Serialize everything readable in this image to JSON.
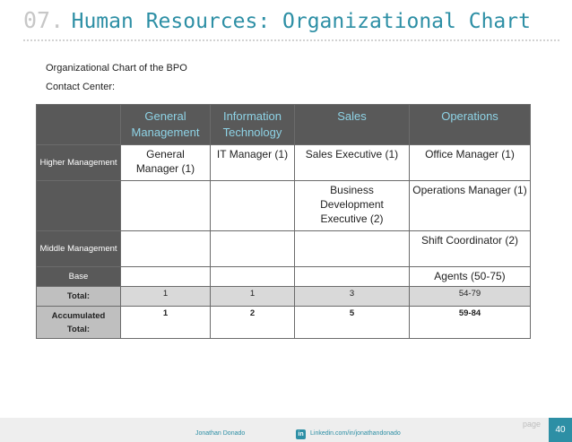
{
  "header": {
    "number": "07.",
    "title": "Human Resources:  Organizational Chart"
  },
  "subtitle": {
    "line1": "Organizational Chart of the BPO",
    "line2": "Contact Center:"
  },
  "table": {
    "columns": [
      "General Management",
      "Information Technology",
      "Sales",
      "Operations"
    ],
    "rows": [
      {
        "label": "Higher Management",
        "cells": [
          "General Manager (1)",
          "IT Manager (1)",
          "Sales Executive (1)",
          "Office Manager (1)"
        ]
      },
      {
        "label": "",
        "cells": [
          "",
          "",
          "Business Development Executive (2)",
          "Operations Manager (1)"
        ]
      },
      {
        "label": "Middle Management",
        "cells": [
          "",
          "",
          "",
          "Shift Coordinator (2)"
        ]
      },
      {
        "label": "Base",
        "cells": [
          "",
          "",
          "",
          "Agents (50-75)"
        ]
      }
    ],
    "total": {
      "label": "Total:",
      "cells": [
        "1",
        "1",
        "3",
        "54-79"
      ]
    },
    "accumulated": {
      "label": "Accumulated Total:",
      "cells": [
        "1",
        "2",
        "5",
        "59-84"
      ]
    }
  },
  "footer": {
    "author": "Jonathan  Donado",
    "linkedin_badge": "in",
    "linkedin": "Linkedin.com/in/jonathandonado",
    "page_label": "page",
    "page_number": "40"
  },
  "colors": {
    "accent": "#2d8fa5",
    "header_bg": "#595959",
    "header_text": "#8ed3e6"
  }
}
